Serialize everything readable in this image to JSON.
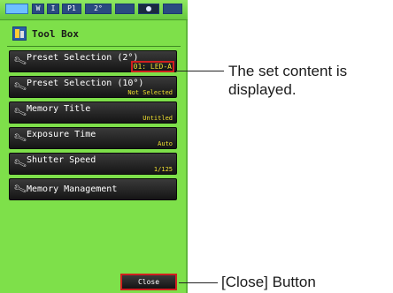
{
  "statusbar": {
    "icons": [
      "battery-icon",
      "w-icon",
      "i-icon",
      "p1-icon",
      "2-deg-icon",
      "blank-icon",
      "dot-icon",
      "signal-icon"
    ],
    "texts": [
      "",
      "W",
      "I",
      "P1",
      "2°",
      "",
      "",
      ""
    ]
  },
  "header": {
    "title": "Tool Box"
  },
  "menu": {
    "items": [
      {
        "label": "Preset Selection (2°)",
        "value": "01: LED-A"
      },
      {
        "label": "Preset Selection (10°)",
        "value": "Not Selected"
      },
      {
        "label": "Memory Title",
        "value": "Untitled"
      },
      {
        "label": "Exposure Time",
        "value": "Auto"
      },
      {
        "label": "Shutter Speed",
        "value": "1/125"
      },
      {
        "label": "Memory Management",
        "value": ""
      }
    ]
  },
  "close_label": "Close",
  "callouts": {
    "set_content_line1": "The set content is",
    "set_content_line2": "displayed.",
    "close_button": "[Close] Button"
  },
  "colors": {
    "screen_bg": "#7ee04a",
    "menu_bg": "#1e1e1e",
    "value_text": "#f0e030",
    "highlight": "#d02020"
  }
}
